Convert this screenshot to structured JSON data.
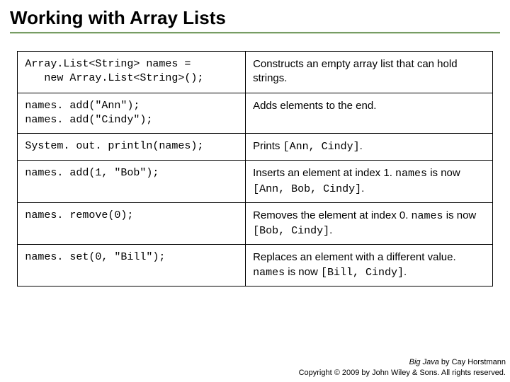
{
  "title": "Working with Array Lists",
  "rows": [
    {
      "code": "Array.List<String> names =\n   new Array.List<String>();",
      "desc_pre": "Constructs an empty array list that can hold strings.",
      "code1": "",
      "desc_mid": "",
      "code2": "",
      "desc_post": ""
    },
    {
      "code": "names. add(\"Ann\");\nnames. add(\"Cindy\");",
      "desc_pre": "Adds elements to the end.",
      "code1": "",
      "desc_mid": "",
      "code2": "",
      "desc_post": ""
    },
    {
      "code": "System. out. println(names);",
      "desc_pre": "Prints ",
      "code1": "[Ann, Cindy]",
      "desc_mid": ".",
      "code2": "",
      "desc_post": ""
    },
    {
      "code": "names. add(1, \"Bob\");",
      "desc_pre": "Inserts an element at index 1. ",
      "code1": "names",
      "desc_mid": " is now ",
      "code2": "[Ann, Bob, Cindy]",
      "desc_post": "."
    },
    {
      "code": "names. remove(0);",
      "desc_pre": "Removes the element at index 0. ",
      "code1": "names",
      "desc_mid": " is now ",
      "code2": "[Bob, Cindy]",
      "desc_post": "."
    },
    {
      "code": "names. set(0, \"Bill\");",
      "desc_pre": "Replaces an element with a different value. ",
      "code1": "names",
      "desc_mid": " is now ",
      "code2": "[Bill, Cindy]",
      "desc_post": "."
    }
  ],
  "footer": {
    "book": "Big Java",
    "by": " by Cay Horstmann",
    "copyright": "Copyright © 2009 by John Wiley & Sons.  All rights reserved."
  }
}
